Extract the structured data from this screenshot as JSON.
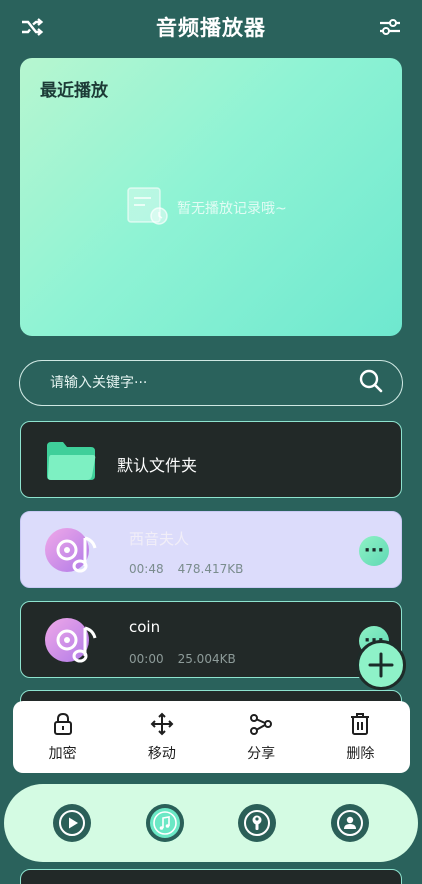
{
  "header": {
    "title": "音频播放器",
    "left_icon": "shuffle-icon",
    "right_icon": "sliders-icon"
  },
  "recent": {
    "label": "最近播放",
    "empty_text": "暂无播放记录哦~"
  },
  "search": {
    "placeholder": "请输入关键字···"
  },
  "folder": {
    "name": "默认文件夹"
  },
  "files": [
    {
      "name": "西音夫人",
      "duration": "00:48",
      "size": "478.417KB",
      "selected": true
    },
    {
      "name": "coin",
      "duration": "00:00",
      "size": "25.004KB",
      "selected": false
    }
  ],
  "more_label": "···",
  "actions": [
    {
      "label": "加密",
      "icon": "lock-icon"
    },
    {
      "label": "移动",
      "icon": "move-icon"
    },
    {
      "label": "分享",
      "icon": "share-icon"
    },
    {
      "label": "删除",
      "icon": "trash-icon"
    }
  ],
  "nav": [
    {
      "icon": "play-icon",
      "active": false
    },
    {
      "icon": "music-icon",
      "active": true
    },
    {
      "icon": "wrench-icon",
      "active": false
    },
    {
      "icon": "user-icon",
      "active": false
    }
  ],
  "colors": {
    "background": "#2a625c",
    "accent": "#8ef2c8",
    "card_dark": "#222928",
    "card_selected": "#dcdcfb"
  }
}
